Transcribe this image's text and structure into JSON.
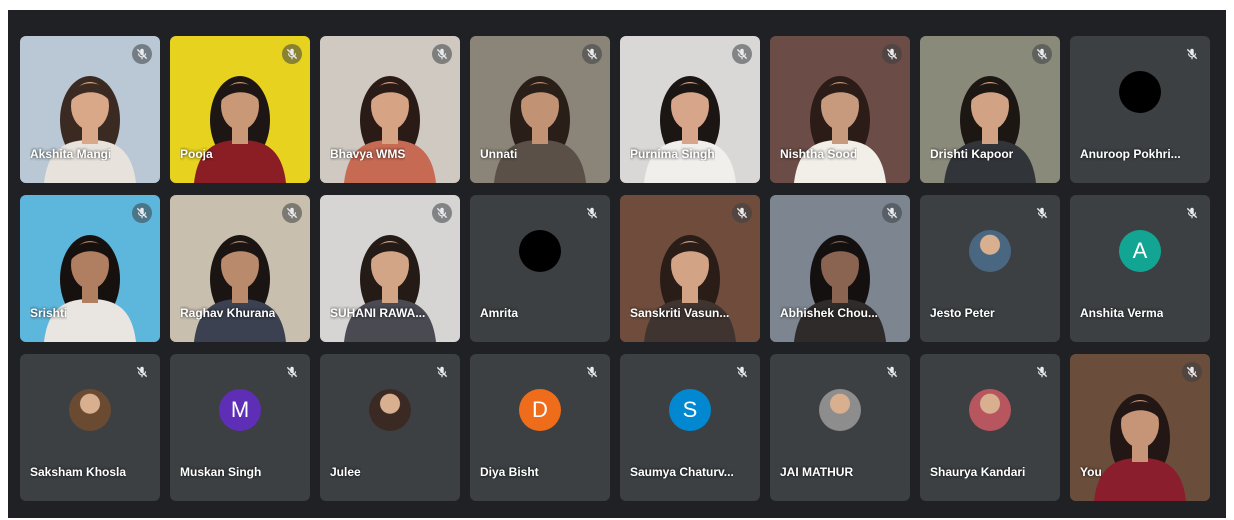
{
  "participants": [
    {
      "name": "Akshita Mangi",
      "kind": "video",
      "bg": "#b9c8d4",
      "shirt": "#e7e2dc",
      "hair": "#3a2a22",
      "skin": "#d9a888"
    },
    {
      "name": "Pooja",
      "kind": "video",
      "bg": "#e6d21f",
      "shirt": "#8a1e24",
      "hair": "#1e1614",
      "skin": "#c99877"
    },
    {
      "name": "Bhavya WMS",
      "kind": "video",
      "bg": "#cfc9c2",
      "shirt": "#c76a53",
      "hair": "#2b1b16",
      "skin": "#d6a384"
    },
    {
      "name": "Unnati",
      "kind": "video",
      "bg": "#8b8478",
      "shirt": "#5a5048",
      "hair": "#2a1e18",
      "skin": "#c19274"
    },
    {
      "name": "Purnima Singh",
      "kind": "video",
      "bg": "#d9d8d6",
      "shirt": "#f1efec",
      "hair": "#1b1513",
      "skin": "#d6a58a"
    },
    {
      "name": "Nishtha Sood",
      "kind": "video",
      "bg": "#6b4c46",
      "shirt": "#f2efe9",
      "hair": "#2b1c18",
      "skin": "#c79a7d"
    },
    {
      "name": "Drishti Kapoor",
      "kind": "video",
      "bg": "#8a8a7a",
      "shirt": "#31353a",
      "hair": "#1d1714",
      "skin": "#d1a283"
    },
    {
      "name": "Anuroop Pokhri...",
      "kind": "avatar",
      "avatar_type": "dark",
      "avatar_color": "#000000"
    },
    {
      "name": "Srishti",
      "kind": "video",
      "bg": "#5db6db",
      "shirt": "#e9e6e1",
      "hair": "#16110f",
      "skin": "#b07f62"
    },
    {
      "name": "Raghav Khurana",
      "kind": "video",
      "bg": "#c9bfae",
      "shirt": "#3b4150",
      "hair": "#1a1412",
      "skin": "#b98a6c"
    },
    {
      "name": "SUHANI RAWA...",
      "kind": "video",
      "bg": "#d6d5d4",
      "shirt": "#4a4a52",
      "hair": "#241a16",
      "skin": "#d3a587"
    },
    {
      "name": "Amrita",
      "kind": "avatar",
      "avatar_type": "dark",
      "avatar_color": "#000000"
    },
    {
      "name": "Sanskriti Vasun...",
      "kind": "video",
      "bg": "#6f4c3c",
      "shirt": "#3f3430",
      "hair": "#2a1d17",
      "skin": "#d2a385"
    },
    {
      "name": "Abhishek Chou...",
      "kind": "video",
      "bg": "#7d8590",
      "shirt": "#2f2b2a",
      "hair": "#141010",
      "skin": "#8a6450"
    },
    {
      "name": "Jesto Peter",
      "kind": "avatar",
      "avatar_type": "photo",
      "avatar_color": "#4a6781"
    },
    {
      "name": "Anshita Verma",
      "kind": "avatar",
      "avatar_type": "letter",
      "letter": "A",
      "avatar_color": "#12a594"
    },
    {
      "name": "Saksham Khosla",
      "kind": "avatar",
      "avatar_type": "photo",
      "avatar_color": "#6b4a32"
    },
    {
      "name": "Muskan Singh",
      "kind": "avatar",
      "avatar_type": "letter",
      "letter": "M",
      "avatar_color": "#5e2fb6"
    },
    {
      "name": "Julee",
      "kind": "avatar",
      "avatar_type": "photo",
      "avatar_color": "#3b2a24"
    },
    {
      "name": "Diya Bisht",
      "kind": "avatar",
      "avatar_type": "letter",
      "letter": "D",
      "avatar_color": "#ef6c1a"
    },
    {
      "name": "Saumya Chaturv...",
      "kind": "avatar",
      "avatar_type": "letter",
      "letter": "S",
      "avatar_color": "#0288d1"
    },
    {
      "name": "JAI MATHUR",
      "kind": "avatar",
      "avatar_type": "photo",
      "avatar_color": "#8d8d8d"
    },
    {
      "name": "Shaurya Kandari",
      "kind": "avatar",
      "avatar_type": "photo",
      "avatar_color": "#b7565f"
    },
    {
      "name": "You",
      "kind": "video",
      "bg": "#6b4d3b",
      "shirt": "#8b1e2d",
      "hair": "#221714",
      "skin": "#c69476"
    }
  ],
  "icons": {
    "mute": "microphone-off-icon"
  }
}
